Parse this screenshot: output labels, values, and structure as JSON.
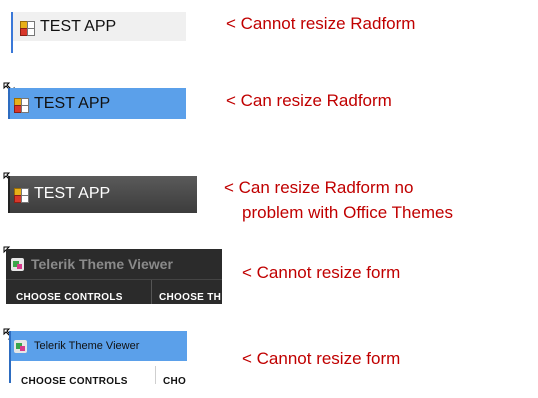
{
  "rows": [
    {
      "title": "TEST APP",
      "note_lines": [
        "<  Cannot resize Radform"
      ]
    },
    {
      "title": "TEST APP",
      "note_lines": [
        "<  Can resize Radform"
      ]
    },
    {
      "title": "TEST APP",
      "note_lines": [
        "<  Can resize Radform no",
        "problem with Office Themes"
      ]
    },
    {
      "title": "Telerik Theme Viewer",
      "menu": [
        "CHOOSE CONTROLS",
        "CHOOSE TH"
      ],
      "note_lines": [
        "<  Cannot resize form"
      ]
    },
    {
      "title": "Telerik Theme Viewer",
      "menu": [
        "CHOOSE CONTROLS",
        "CHO"
      ],
      "note_lines": [
        "<  Cannot resize form"
      ]
    }
  ],
  "colors": {
    "note": "#c00000",
    "row1_bg": "#f0f0f0",
    "row2_bg": "#5ba0ea",
    "row3_bg": "#4a4a4a",
    "row4_bg": "#2b2b2b",
    "row5_bg": "#5ba0ea"
  }
}
